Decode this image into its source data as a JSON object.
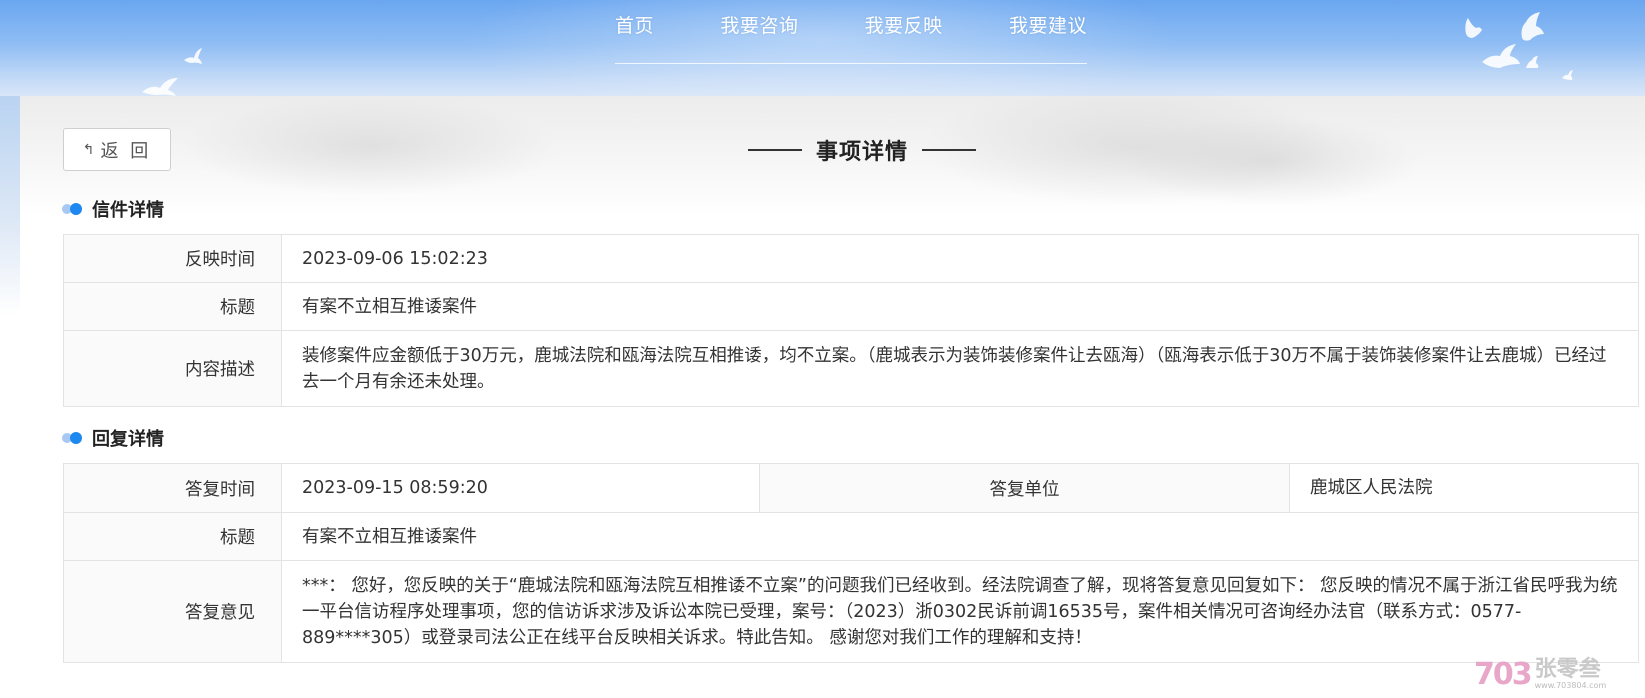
{
  "nav": {
    "items": [
      {
        "label": "首页"
      },
      {
        "label": "我要咨询"
      },
      {
        "label": "我要反映"
      },
      {
        "label": "我要建议"
      }
    ]
  },
  "back_button": {
    "label": "返 回",
    "icon": "arrow-back-icon"
  },
  "page_title": "事项详情",
  "letter_section": {
    "title": "信件详情",
    "rows": [
      {
        "label": "反映时间",
        "value": "2023-09-06 15:02:23"
      },
      {
        "label": "标题",
        "value": "有案不立相互推诿案件"
      },
      {
        "label": "内容描述",
        "value": "装修案件应金额低于30万元，鹿城法院和瓯海法院互相推诿，均不立案。（鹿城表示为装饰装修案件让去瓯海）（瓯海表示低于30万不属于装饰装修案件让去鹿城）已经过去一个月有余还未处理。"
      }
    ]
  },
  "reply_section": {
    "title": "回复详情",
    "reply_time_label": "答复时间",
    "reply_time": "2023-09-15 08:59:20",
    "reply_unit_label": "答复单位",
    "reply_unit": "鹿城区人民法院",
    "title_label": "标题",
    "title_value": "有案不立相互推诿案件",
    "opinion_label": "答复意见",
    "opinion": "***：  您好，您反映的关于“鹿城法院和瓯海法院互相推诿不立案”的问题我们已经收到。经法院调查了解，现将答复意见回复如下： 您反映的情况不属于浙江省民呼我为统一平台信访程序处理事项，您的信访诉求涉及诉讼本院已受理，案号：（2023）浙0302民诉前调16535号，案件相关情况可咨询经办法官（联系方式：0577- 889****305）或登录司法公正在线平台反映相关诉求。特此告知。 感谢您对我们工作的理解和支持！"
  },
  "watermark": {
    "logo": "703",
    "name": "张零叁",
    "url": "www.703804.com"
  },
  "colors": {
    "banner_top": "#6aa6f0",
    "accent_dot": "#1d88f0",
    "label_bg": "#fafafa",
    "border": "#e3e3e3"
  }
}
